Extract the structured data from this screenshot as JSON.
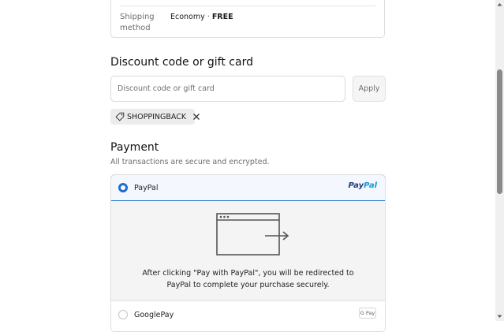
{
  "shipping": {
    "label": "Shipping method",
    "method": "Economy",
    "separator": " · ",
    "price": "FREE"
  },
  "discount": {
    "heading": "Discount code or gift card",
    "placeholder": "Discount code or gift card",
    "apply_label": "Apply",
    "applied_code": "SHOPPINGBACK"
  },
  "payment": {
    "heading": "Payment",
    "subtext": "All transactions are secure and encrypted.",
    "options": [
      {
        "label": "PayPal",
        "selected": true,
        "logo_text_1": "Pay",
        "logo_text_2": "Pal"
      },
      {
        "label": "GooglePay",
        "selected": false,
        "badge_text": "G Pay"
      }
    ],
    "redirect_text": "After clicking \"Pay with PayPal\", you will be redirected to PayPal to complete your purchase securely."
  },
  "colors": {
    "accent": "#1a6fd1",
    "paypal_dark": "#253b80",
    "paypal_light": "#179bd7"
  }
}
